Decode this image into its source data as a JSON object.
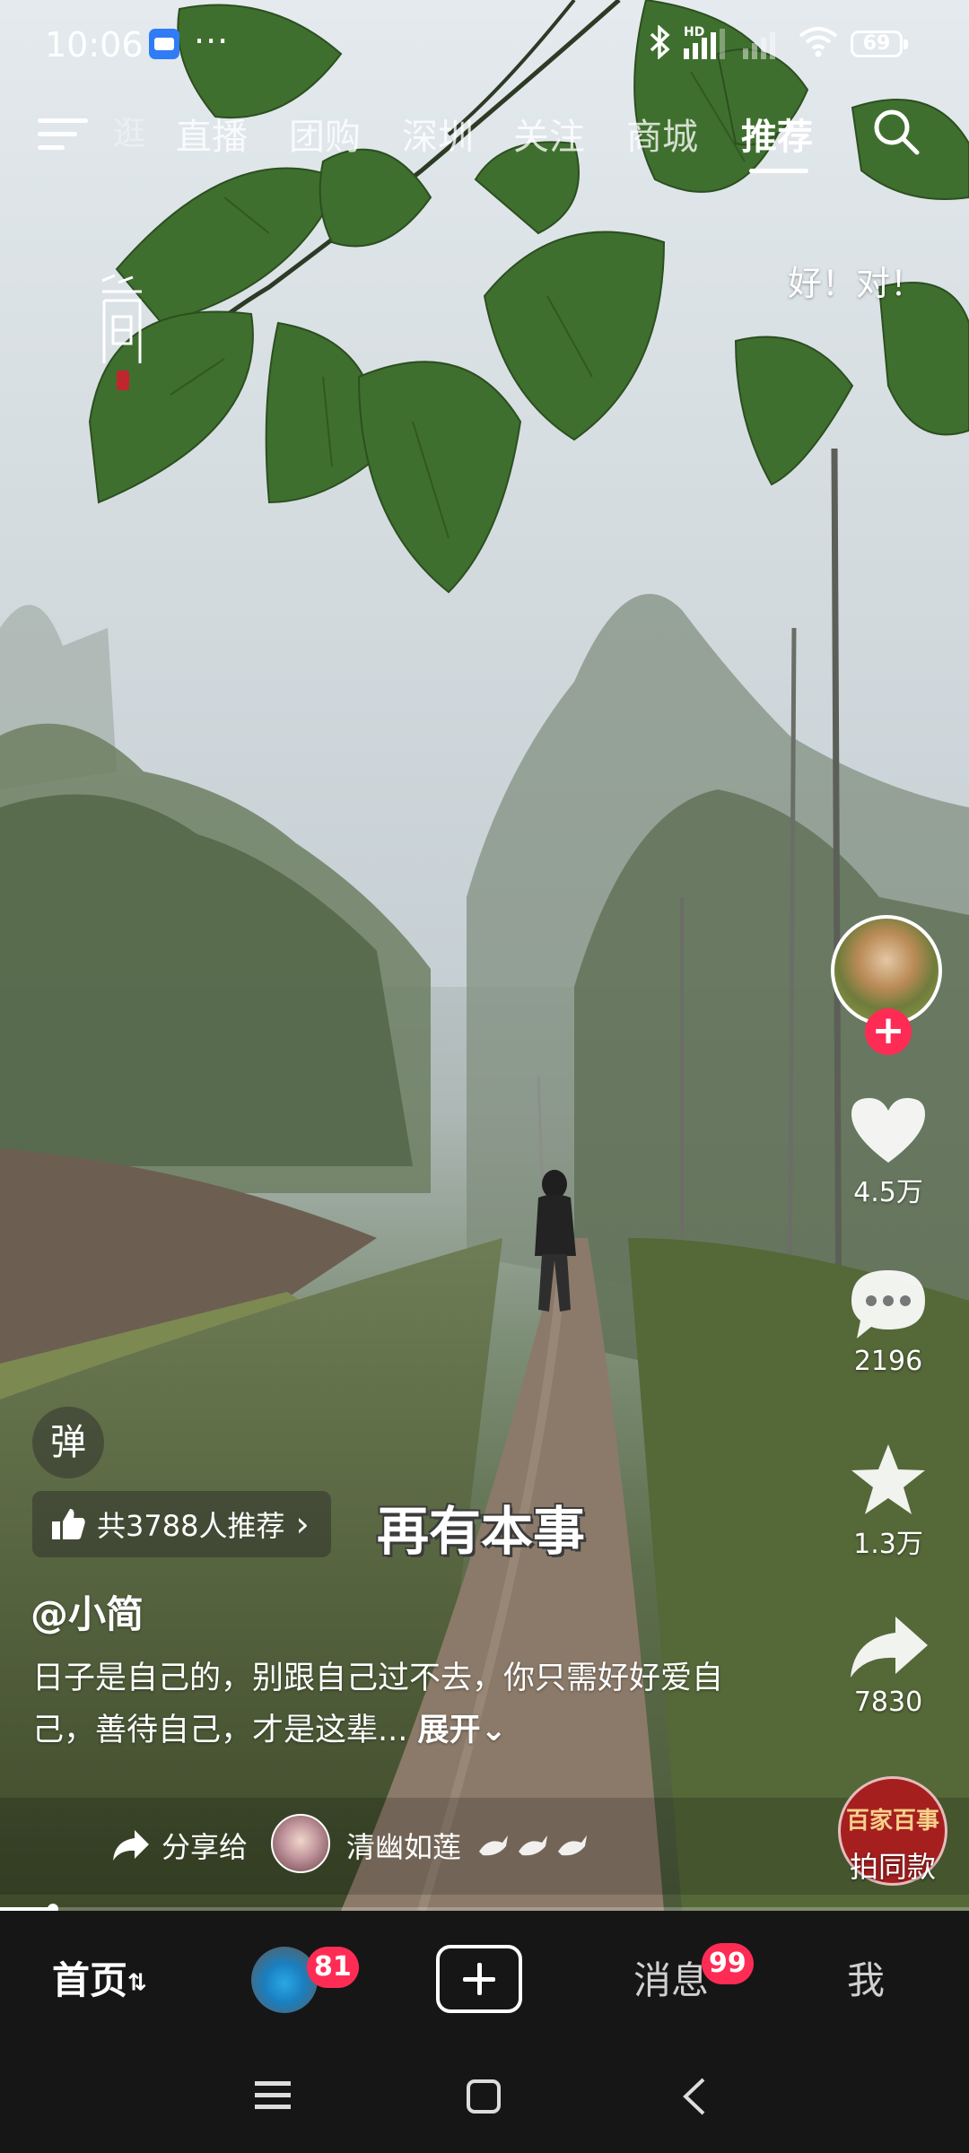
{
  "status_bar": {
    "time": "10:06",
    "more": "···",
    "network_label": "HD",
    "battery": "69",
    "icons": [
      "wallet-icon",
      "bluetooth-icon",
      "signal-icon",
      "wifi-icon",
      "battery-icon"
    ]
  },
  "top_tabs": {
    "items": [
      "直播",
      "团购",
      "深圳",
      "关注",
      "商城",
      "推荐"
    ],
    "active": "推荐",
    "partial_left": "逛"
  },
  "video": {
    "danmu_text": "好！对！",
    "caption_overlay": "再有本事"
  },
  "author_panel": {
    "likes": "4.5万",
    "comments": "2196",
    "favorites": "1.3万",
    "shares": "7830",
    "follow_symbol": "+"
  },
  "bottom_left": {
    "danmaku_toggle": "弹",
    "recommend_text": "共3788人推荐",
    "recommend_chevron": "›",
    "author": "@小简",
    "description": "日子是自己的，别跟自己过不去，你只需好好爱自己，善待自己，才是这辈...",
    "expand_label": "展开",
    "share_label": "分享给",
    "share_user": "清幽如莲"
  },
  "same_style": {
    "brand": "百家百事",
    "label": "拍同款"
  },
  "playback": {
    "progress": 0.055
  },
  "bottom_nav": {
    "home": "首页",
    "friends_badge": "81",
    "messages": "消息",
    "messages_badge": "99",
    "me": "我"
  },
  "colors": {
    "accent": "#fe2c55",
    "nav_bg": "#161616",
    "leaf": "#3f6f2e"
  }
}
